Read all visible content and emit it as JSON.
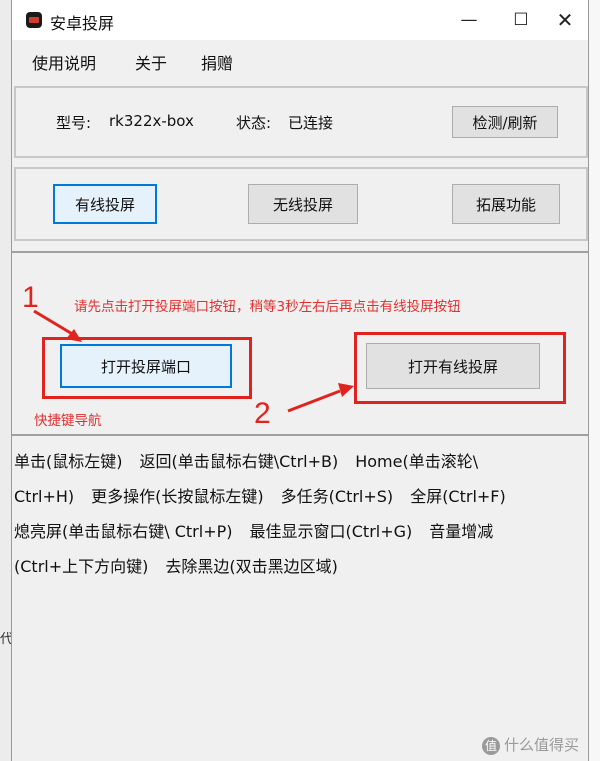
{
  "window": {
    "title": "安卓投屏",
    "minimize": "—",
    "maximize": "☐",
    "close": "✕"
  },
  "menu": [
    "使用说明",
    "关于",
    "捐赠"
  ],
  "device": {
    "model_label": "型号:",
    "model_value": "rk322x-box",
    "status_label": "状态:",
    "status_value": "已连接",
    "refresh_button": "检测/刷新"
  },
  "modes": [
    "有线投屏",
    "无线投屏",
    "拓展功能"
  ],
  "wired": {
    "hint": "请先点击打开投屏端口按钮，稍等3秒左右后再点击有线投屏按钮",
    "open_port_button": "打开投屏端口",
    "open_wired_button": "打开有线投屏",
    "shortcut_label": "快捷键导航",
    "annotation_1": "1",
    "annotation_2": "2"
  },
  "help_lines": [
    [
      "单击(鼠标左键)",
      "返回(单击鼠标右键\\Ctrl+B)",
      "Home(单击滚轮\\"
    ],
    [
      "Ctrl+H)",
      "更多操作(长按鼠标左键)",
      "多任务(Ctrl+S)",
      "全屏(Ctrl+F)"
    ],
    [
      "熄亮屏(单击鼠标右键\\ Ctrl+P)",
      "最佳显示窗口(Ctrl+G)",
      "音量增减"
    ],
    [
      "(Ctrl+上下方向键)",
      "去除黑边(双击黑边区域)"
    ]
  ],
  "edge_char": "代",
  "watermark": {
    "logo": "值",
    "text": "什么值得买"
  },
  "colors": {
    "annotation_red": "#e0231e",
    "focus_blue": "#0078d7"
  }
}
